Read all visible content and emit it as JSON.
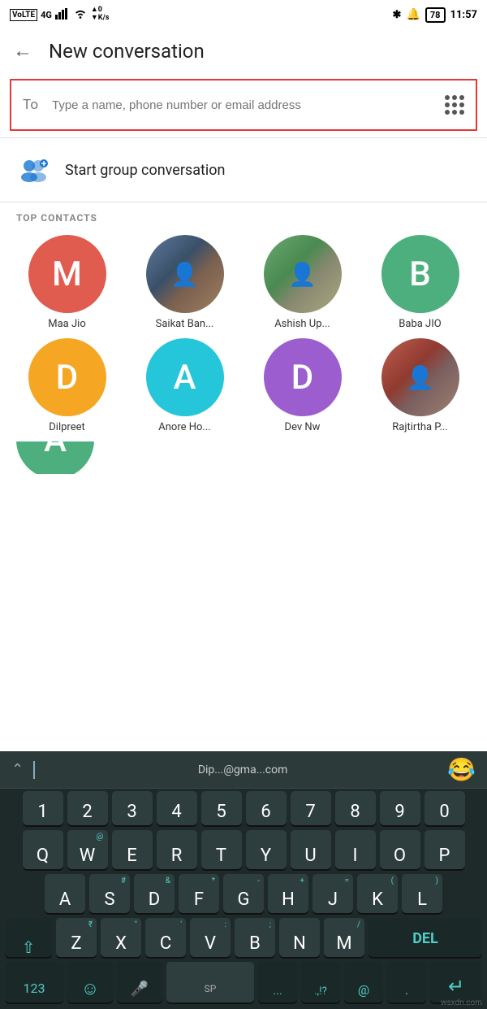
{
  "statusBar": {
    "left": "VoLTE 4G",
    "signal": "▲▼ 0 K/s",
    "bluetooth": "✱",
    "bell_muted": "🔔",
    "battery": "78",
    "time": "11:57"
  },
  "appBar": {
    "title": "New conversation",
    "back_label": "←"
  },
  "toField": {
    "label": "To",
    "placeholder": "Type a name, phone number or email address"
  },
  "groupConversation": {
    "label": "Start group conversation"
  },
  "topContacts": {
    "sectionLabel": "TOP CONTACTS",
    "contacts": [
      {
        "name": "Maa Jio",
        "initial": "M",
        "color": "#e05c4e",
        "hasPhoto": false
      },
      {
        "name": "Saikat Ban...",
        "initial": "",
        "color": "#bdbdbd",
        "hasPhoto": true,
        "photoIndex": 0
      },
      {
        "name": "Ashish Up...",
        "initial": "",
        "color": "#bdbdbd",
        "hasPhoto": true,
        "photoIndex": 1
      },
      {
        "name": "Baba JIO",
        "initial": "B",
        "color": "#4caf7d",
        "hasPhoto": false
      },
      {
        "name": "Dilpreet",
        "initial": "D",
        "color": "#f5a623",
        "hasPhoto": false
      },
      {
        "name": "Anore Ho...",
        "initial": "A",
        "color": "#26c6da",
        "hasPhoto": false
      },
      {
        "name": "Dev Nw",
        "initial": "D",
        "color": "#9c5ecf",
        "hasPhoto": false
      },
      {
        "name": "Rajtirtha P...",
        "initial": "",
        "color": "#bdbdbd",
        "hasPhoto": true,
        "photoIndex": 2
      }
    ]
  },
  "keyboard": {
    "suggestion": "Dip...@gma...com",
    "emoji_suggest": "😂",
    "rows": {
      "numbers": [
        "1",
        "2",
        "3",
        "4",
        "5",
        "6",
        "7",
        "8",
        "9",
        "0"
      ],
      "row1": [
        "Q",
        "W",
        "E",
        "R",
        "T",
        "Y",
        "U",
        "I",
        "O",
        "P"
      ],
      "row1_sub": [
        "",
        "@",
        "",
        "",
        "",
        "",
        "",
        "",
        "",
        ""
      ],
      "row2": [
        "A",
        "S",
        "D",
        "F",
        "G",
        "H",
        "J",
        "K",
        "L"
      ],
      "row2_sub": [
        "",
        "#",
        "&",
        "*",
        "-",
        "+",
        "=",
        "(",
        "",
        ")",
        "."
      ],
      "row3": [
        "Z",
        "X",
        "C",
        "V",
        "B",
        "N",
        "M"
      ],
      "row3_sub": [
        "₹",
        "\"",
        "'",
        ":",
        ";",
        " ",
        "/"
      ],
      "special_left": "123",
      "emoji_key": "☺",
      "mic_key": "🎤",
      "space_label": "SP",
      "dots_key": "...",
      "punctuation": ".,!?",
      "at_key": "@",
      "period_key": ".",
      "del_key": "DEL",
      "enter_key": "↵",
      "shift_key": "⇧"
    }
  },
  "watermark": "wsxdn.com"
}
